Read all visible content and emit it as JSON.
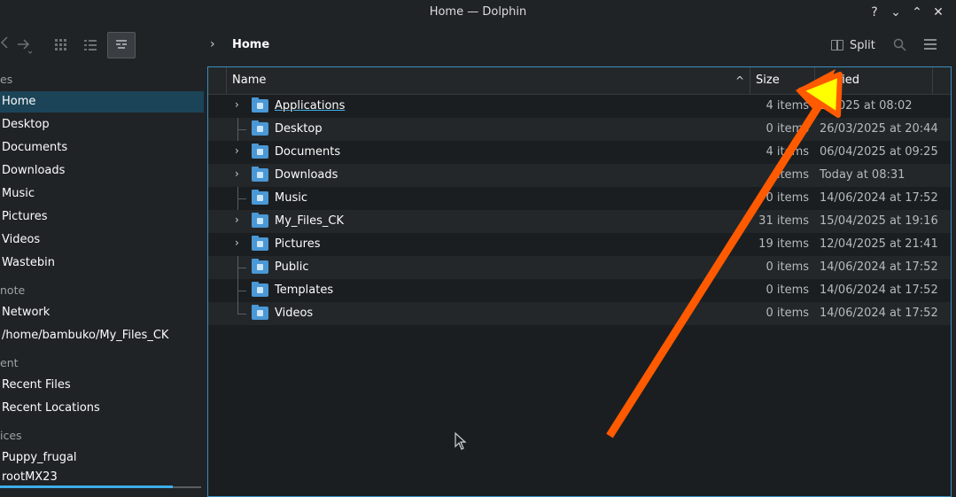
{
  "window": {
    "title": "Home — Dolphin",
    "controls": [
      "?",
      "⌄",
      "⌃",
      "✕"
    ]
  },
  "toolbar": {
    "back_icon": "arrow-left-icon",
    "forward_icon": "arrow-right-icon",
    "view_icons": [
      "grid-view-icon",
      "list-view-icon",
      "detail-view-icon"
    ],
    "breadcrumb_separator": "›",
    "breadcrumb": "Home",
    "split_label": "Split",
    "search_icon": "search-icon",
    "menu_icon": "hamburger-menu-icon"
  },
  "sidebar": {
    "sections": [
      {
        "label": "es"
      },
      {
        "label": "note"
      },
      {
        "label": "ent"
      },
      {
        "label": "ices"
      }
    ],
    "items": [
      {
        "label": "Home",
        "selected": true
      },
      {
        "label": "Desktop"
      },
      {
        "label": "Documents"
      },
      {
        "label": "Downloads"
      },
      {
        "label": "Music"
      },
      {
        "label": "Pictures"
      },
      {
        "label": "Videos"
      },
      {
        "label": "Wastebin"
      },
      {
        "label": "Network"
      },
      {
        "label": "/home/bambuko/My_Files_CK"
      },
      {
        "label": "Recent Files"
      },
      {
        "label": "Recent Locations"
      },
      {
        "label": "Puppy_frugal"
      },
      {
        "label": "rootMX23"
      }
    ]
  },
  "table": {
    "columns": [
      "Name",
      "Size",
      "ified"
    ],
    "rows": [
      {
        "name": "Applications",
        "size": "4 items",
        "modified": "2/2025 at 08:02",
        "expandable": true
      },
      {
        "name": "Desktop",
        "size": "0 items",
        "modified": "26/03/2025 at 20:44",
        "expandable": false
      },
      {
        "name": "Documents",
        "size": "4 items",
        "modified": "06/04/2025 at 09:25",
        "expandable": true
      },
      {
        "name": "Downloads",
        "size": "items",
        "modified": "Today at 08:31",
        "expandable": true
      },
      {
        "name": "Music",
        "size": "0 items",
        "modified": "14/06/2024 at 17:52",
        "expandable": false
      },
      {
        "name": "My_Files_CK",
        "size": "31 items",
        "modified": "15/04/2025 at 19:16",
        "expandable": true
      },
      {
        "name": "Pictures",
        "size": "19 items",
        "modified": "12/04/2025 at 21:41",
        "expandable": true
      },
      {
        "name": "Public",
        "size": "0 items",
        "modified": "14/06/2024 at 17:52",
        "expandable": false
      },
      {
        "name": "Templates",
        "size": "0 items",
        "modified": "14/06/2024 at 17:52",
        "expandable": false
      },
      {
        "name": "Videos",
        "size": "0 items",
        "modified": "14/06/2024 at 17:52",
        "expandable": false
      }
    ]
  },
  "annotation": {
    "arrow_color": "#ff5a00",
    "triangle_color": "#ffff00"
  },
  "colors": {
    "accent": "#3daee9",
    "background": "#202326",
    "selection": "#1c4458",
    "folder": "#4a98d6"
  }
}
